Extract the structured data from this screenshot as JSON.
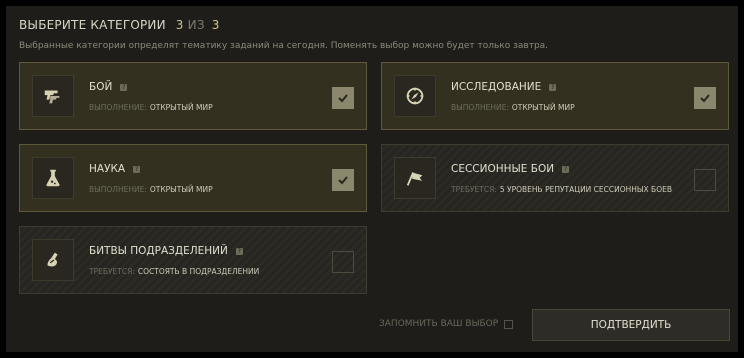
{
  "header": {
    "title": "ВЫБЕРИТЕ КАТЕГОРИИ",
    "count_selected": "3",
    "count_of": "ИЗ",
    "count_total": "3",
    "subtitle": "Выбранные категории определят тематику заданий на сегодня. Поменять выбор можно будет только завтра."
  },
  "categories": [
    {
      "title": "БОЙ",
      "req_label": "ВЫПОЛНЕНИЕ:",
      "req_value": "ОТКРЫТЫЙ МИР",
      "selected": true,
      "icon": "guns-icon"
    },
    {
      "title": "ИССЛЕДОВАНИЕ",
      "req_label": "ВЫПОЛНЕНИЕ:",
      "req_value": "ОТКРЫТЫЙ МИР",
      "selected": true,
      "icon": "compass-icon"
    },
    {
      "title": "НАУКА",
      "req_label": "ВЫПОЛНЕНИЕ:",
      "req_value": "ОТКРЫТЫЙ МИР",
      "selected": true,
      "icon": "flask-icon"
    },
    {
      "title": "СЕССИОННЫЕ БОИ",
      "req_label": "ТРЕБУЕТСЯ:",
      "req_value": "5 УРОВЕНЬ РЕПУТАЦИИ СЕССИОННЫХ БОЕВ",
      "selected": false,
      "icon": "flag-icon"
    },
    {
      "title": "БИТВЫ ПОДРАЗДЕЛЕНИЙ",
      "req_label": "ТРЕБУЕТСЯ:",
      "req_value": "СОСТОЯТЬ В ПОДРАЗДЕЛЕНИИ",
      "selected": false,
      "icon": "squad-icon"
    }
  ],
  "info_glyph": "?",
  "footer": {
    "remember_label": "ЗАПОМНИТЬ ВАШ ВЫБОР",
    "confirm_label": "ПОДТВЕРДИТЬ"
  },
  "colors": {
    "background": "#1e1d19",
    "selected_card": "#33301f",
    "accent": "#d0c48a",
    "checkbox_on": "#8b876c"
  }
}
